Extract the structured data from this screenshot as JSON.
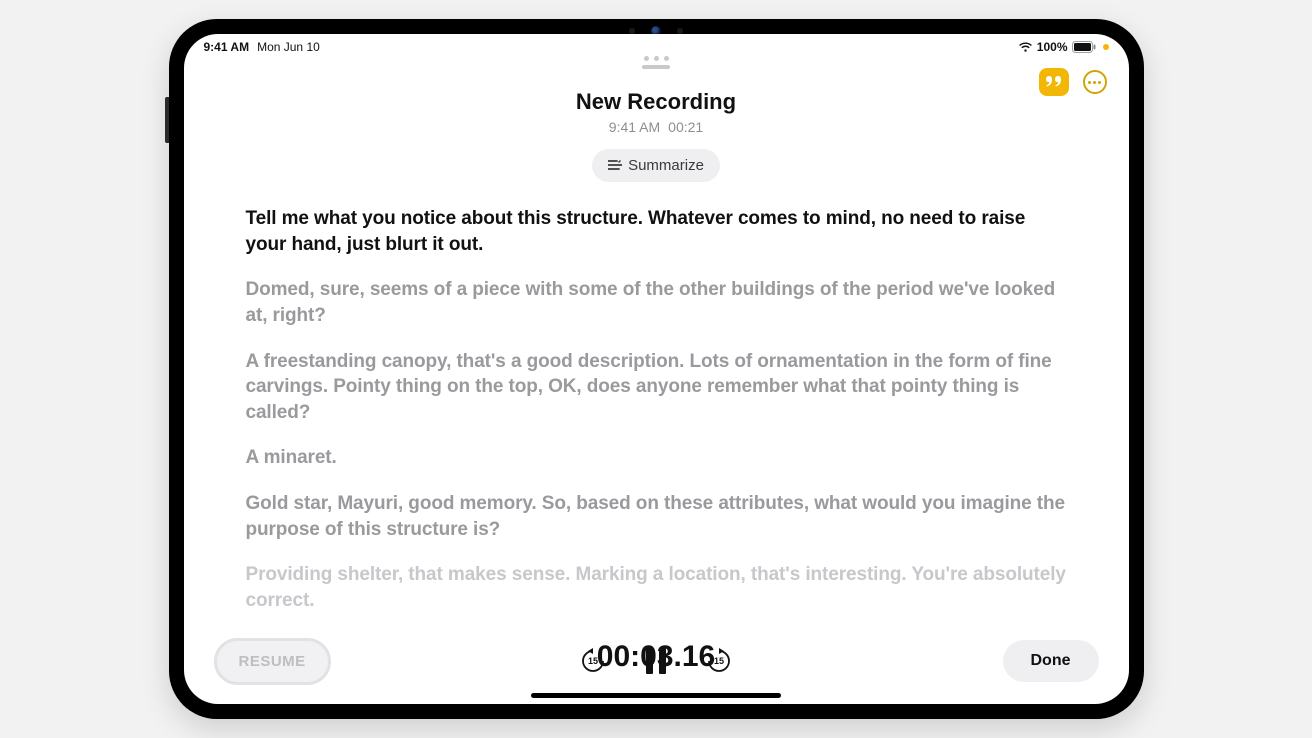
{
  "status": {
    "time": "9:41 AM",
    "date": "Mon Jun 10",
    "battery_pct": "100%"
  },
  "top_actions": {
    "quote_icon": "quote",
    "more_icon": "ellipsis"
  },
  "header": {
    "title": "New Recording",
    "time": "9:41 AM",
    "duration": "00:21",
    "summarize_label": "Summarize"
  },
  "transcript": {
    "paragraphs": [
      "Tell me what you notice about this structure. Whatever comes to mind, no need to raise your hand, just blurt it out.",
      "Domed, sure, seems of a piece with some of the other buildings of the period we've looked at, right?",
      "A freestanding canopy, that's a good description. Lots of ornamentation in the form of fine carvings. Pointy thing on the top, OK, does anyone remember what that pointy thing is called?",
      "A minaret.",
      "Gold star, Mayuri, good memory. So, based on these attributes, what would you imagine the purpose of this structure is?",
      "Providing shelter, that makes sense. Marking a location, that's interesting. You're absolutely correct."
    ]
  },
  "playback": {
    "timecode": "00:03.16",
    "skip_back_seconds": "15",
    "skip_fwd_seconds": "15",
    "resume_label": "RESUME",
    "done_label": "Done"
  }
}
